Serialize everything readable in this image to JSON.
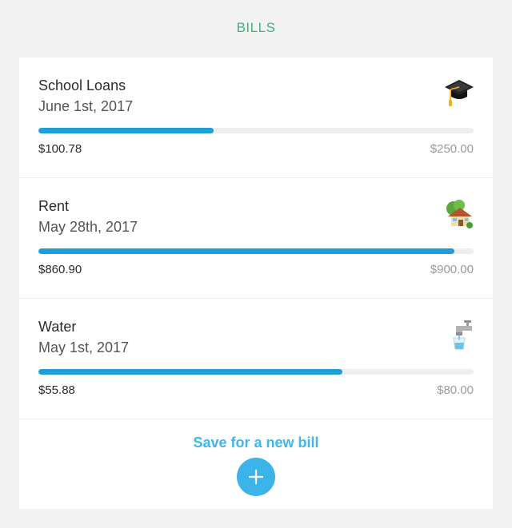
{
  "header": {
    "title": "BILLS"
  },
  "bills": [
    {
      "name": "School Loans",
      "date": "June 1st, 2017",
      "saved": "$100.78",
      "goal": "$250.00",
      "progress": 0.4031,
      "icon": "graduation-cap-icon"
    },
    {
      "name": "Rent",
      "date": "May 28th, 2017",
      "saved": "$860.90",
      "goal": "$900.00",
      "progress": 0.9566,
      "icon": "house-icon"
    },
    {
      "name": "Water",
      "date": "May 1st, 2017",
      "saved": "$55.88",
      "goal": "$80.00",
      "progress": 0.6985,
      "icon": "faucet-icon"
    }
  ],
  "new_bill": {
    "label": "Save for a new bill",
    "icon": "plus-icon"
  },
  "colors": {
    "header": "#3fb27f",
    "progress": "#1e9ed6",
    "track": "#eeeeee",
    "accent": "#3cb4ea"
  }
}
